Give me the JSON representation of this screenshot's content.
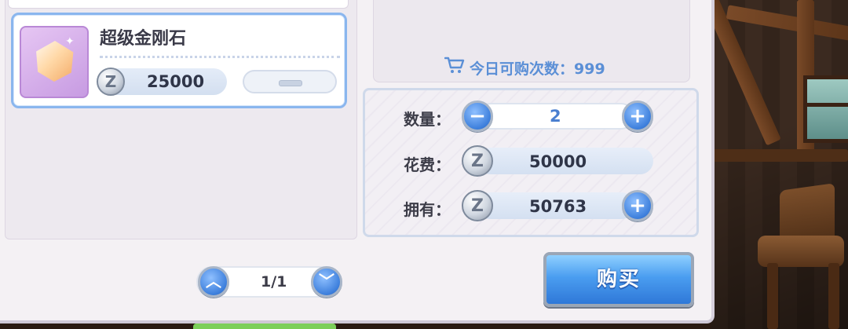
{
  "item": {
    "name": "超级金刚石",
    "price": "25000",
    "coin_symbol": "Z",
    "quantity_control": "minus"
  },
  "shop": {
    "daily_limit_label": "今日可购次数：999"
  },
  "details": {
    "quantity_label": "数量：",
    "quantity_value": "2",
    "cost_label": "花费：",
    "cost_value": "50000",
    "owned_label": "拥有：",
    "owned_value": "50763"
  },
  "pagination": {
    "page_text": "1/1"
  },
  "buttons": {
    "buy_label": "购买",
    "decrease_symbol": "−",
    "increase_symbol": "+",
    "add_currency_symbol": "+",
    "page_up_symbol": "︿",
    "page_down_symbol": "﹀"
  },
  "icons": {
    "cart": "cart-icon",
    "coin": "zeny-coin-icon",
    "item": "diamond-icon"
  },
  "colors": {
    "accent_blue": "#4a9df0",
    "label_blue": "#5b8fd6",
    "card_border": "#8ab6ee"
  }
}
